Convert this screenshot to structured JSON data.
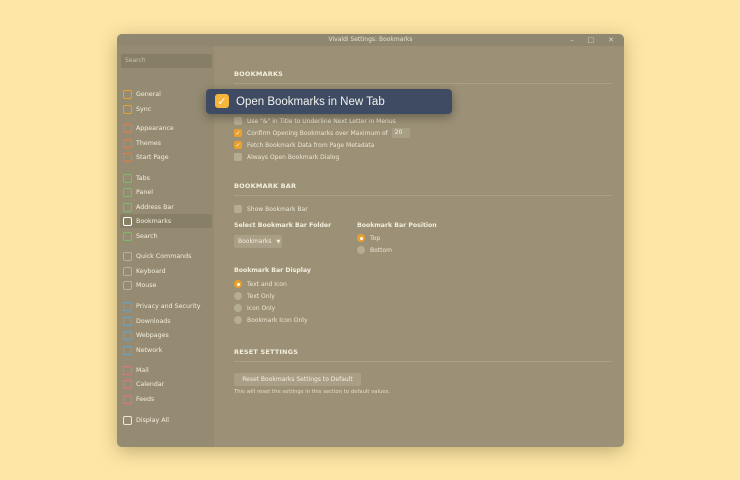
{
  "window": {
    "title": "Vivaldi Settings: Bookmarks"
  },
  "sidebar": {
    "search_placeholder": "Search",
    "items": [
      {
        "label": "General",
        "icon": "general-icon",
        "color": "#e8a12c"
      },
      {
        "label": "Sync",
        "icon": "cloud-icon",
        "color": "#e8a12c"
      },
      {
        "label": "Appearance",
        "icon": "appearance-icon",
        "color": "#e87c3a"
      },
      {
        "label": "Themes",
        "icon": "brush-icon",
        "color": "#e87c3a"
      },
      {
        "label": "Start Page",
        "icon": "start-page-icon",
        "color": "#e87c3a"
      },
      {
        "label": "Tabs",
        "icon": "tabs-icon",
        "color": "#7fb86a"
      },
      {
        "label": "Panel",
        "icon": "panel-icon",
        "color": "#7fb86a"
      },
      {
        "label": "Address Bar",
        "icon": "address-bar-icon",
        "color": "#7fb86a"
      },
      {
        "label": "Bookmarks",
        "icon": "bookmark-icon",
        "color": "#ffffff"
      },
      {
        "label": "Search",
        "icon": "search-icon",
        "color": "#7fb86a"
      },
      {
        "label": "Quick Commands",
        "icon": "quick-commands-icon",
        "color": "#b9b09a"
      },
      {
        "label": "Keyboard",
        "icon": "keyboard-icon",
        "color": "#b9b09a"
      },
      {
        "label": "Mouse",
        "icon": "mouse-icon",
        "color": "#b9b09a"
      },
      {
        "label": "Privacy and Security",
        "icon": "privacy-icon",
        "color": "#5aa7d6"
      },
      {
        "label": "Downloads",
        "icon": "download-icon",
        "color": "#5aa7d6"
      },
      {
        "label": "Webpages",
        "icon": "globe-icon",
        "color": "#5aa7d6"
      },
      {
        "label": "Network",
        "icon": "network-icon",
        "color": "#5aa7d6"
      },
      {
        "label": "Mail",
        "icon": "mail-icon",
        "color": "#e8727a"
      },
      {
        "label": "Calendar",
        "icon": "calendar-icon",
        "color": "#e8727a"
      },
      {
        "label": "Feeds",
        "icon": "feed-icon",
        "color": "#e8727a"
      },
      {
        "label": "Display All",
        "icon": "gear-icon",
        "color": "#ece6d4"
      }
    ]
  },
  "bookmarks": {
    "title": "BOOKMARKS",
    "options": [
      {
        "label": "Use \"&\" in Title to Underline Next Letter in Menus",
        "checked": false
      },
      {
        "label": "Confirm Opening Bookmarks over Maximum of",
        "checked": true,
        "value": "20"
      },
      {
        "label": "Fetch Bookmark Data from Page Metadata",
        "checked": true
      },
      {
        "label": "Always Open Bookmark Dialog",
        "checked": false
      }
    ]
  },
  "bookmark_bar": {
    "title": "BOOKMARK BAR",
    "show_label": "Show Bookmark Bar",
    "folder_title": "Select Bookmark Bar Folder",
    "folder_value": "Bookmarks",
    "position_title": "Bookmark Bar Position",
    "positions": [
      {
        "label": "Top",
        "selected": true
      },
      {
        "label": "Bottom",
        "selected": false
      }
    ],
    "display_title": "Bookmark Bar Display",
    "displays": [
      {
        "label": "Text and Icon",
        "selected": true
      },
      {
        "label": "Text Only",
        "selected": false
      },
      {
        "label": "Icon Only",
        "selected": false
      },
      {
        "label": "Bookmark Icon Only",
        "selected": false
      }
    ]
  },
  "reset": {
    "title": "RESET SETTINGS",
    "button": "Reset Bookmarks Settings to Default",
    "note": "This will reset the settings in this section to default values."
  },
  "popup": {
    "label": "Open Bookmarks in New Tab",
    "checked": true
  }
}
